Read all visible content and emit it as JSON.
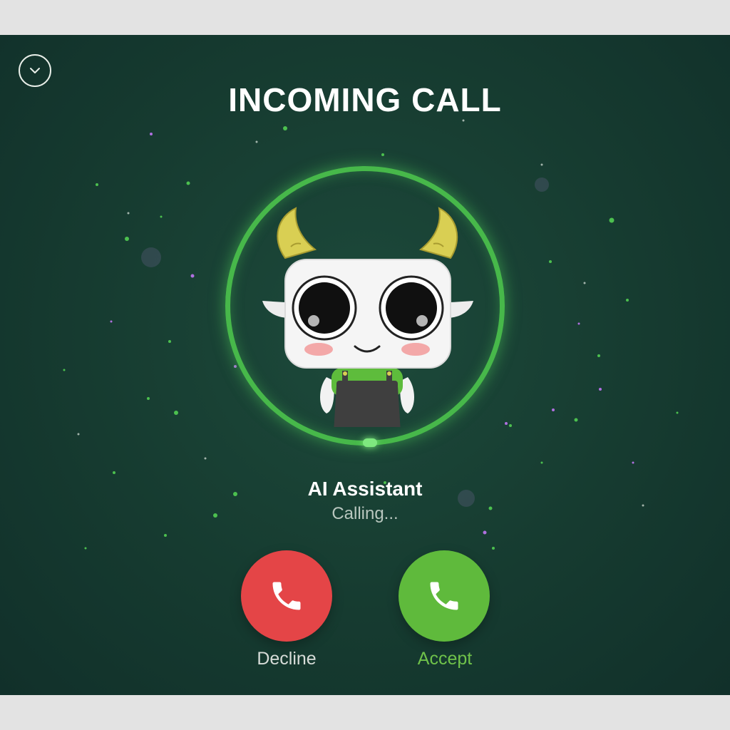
{
  "header": {
    "title": "INCOMING CALL",
    "minimize_icon": "chevron-down-icon"
  },
  "caller": {
    "name": "AI Assistant",
    "status": "Calling...",
    "avatar_icon": "horned-robot-avatar"
  },
  "actions": {
    "decline_label": "Decline",
    "accept_label": "Accept",
    "decline_icon": "phone-icon",
    "accept_icon": "phone-icon"
  },
  "colors": {
    "background": "#163b30",
    "ring": "#47b84a",
    "decline": "#e44547",
    "accept": "#5fba3c",
    "accept_text": "#6fc24a"
  }
}
